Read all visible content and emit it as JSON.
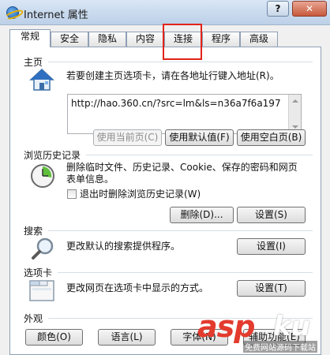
{
  "window": {
    "title": "Internet 属性",
    "help_glyph": "?",
    "close_glyph": "✕"
  },
  "tabs": [
    {
      "label": "常规",
      "active": true
    },
    {
      "label": "安全"
    },
    {
      "label": "隐私"
    },
    {
      "label": "内容"
    },
    {
      "label": "连接",
      "highlighted": true
    },
    {
      "label": "程序"
    },
    {
      "label": "高级"
    }
  ],
  "homepage": {
    "title": "主页",
    "desc": "若要创建主页选项卡，请在各地址行键入地址(R)。",
    "address": "http://hao.360.cn/?src=lm&ls=n36a7f6a197",
    "btn_current": "使用当前页(C)",
    "btn_default": "使用默认值(F)",
    "btn_blank": "使用空白页(B)"
  },
  "history": {
    "title": "浏览历史记录",
    "desc_line1": "删除临时文件、历史记录、Cookie、保存的密码和网页",
    "desc_line2": "表单信息。",
    "checkbox_label": "退出时删除浏览历史记录(W)",
    "btn_delete": "删除(D)...",
    "btn_settings": "设置(S)"
  },
  "search": {
    "title": "搜索",
    "desc": "更改默认的搜索提供程序。",
    "btn_settings": "设置(I)"
  },
  "tabs_section": {
    "title": "选项卡",
    "desc": "更改网页在选项卡中显示的方式。",
    "btn_settings": "设置(T)"
  },
  "appearance": {
    "title": "外观",
    "btn_colors": "颜色(O)",
    "btn_languages": "语言(L)",
    "btn_fonts": "字体(N)",
    "btn_access": "辅助功能(E)"
  },
  "watermark": {
    "brand_a": "asp",
    "brand_b": "ku",
    "sub": "免费网站源码下载站"
  },
  "colors": {
    "highlight_red": "#e2231a",
    "accent_blue": "#1c5fb0"
  }
}
